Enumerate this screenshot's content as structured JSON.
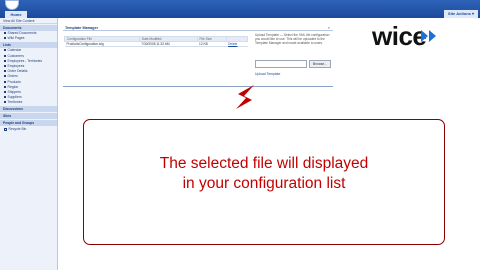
{
  "topbar": {
    "home_tab": "Home",
    "site_actions": "Site Actions ▾"
  },
  "sidebar": {
    "header": "View All Site Content",
    "groups": [
      {
        "label": "Documents",
        "items": [
          "Shared Documents",
          "Wiki Pages"
        ]
      },
      {
        "label": "Lists",
        "items": [
          "Calendar",
          "Customers",
          "Employees - Territories",
          "Employees",
          "Order Details",
          "Orders",
          "Products",
          "Region",
          "Shippers",
          "Suppliers",
          "Territories"
        ]
      }
    ],
    "discussions": "Discussions",
    "sites": "Sites",
    "people": "People and Groups",
    "recycle": "Recycle Bin"
  },
  "main": {
    "panel_title": "Template Manager",
    "panel_close": "×",
    "table": {
      "headers": [
        "Configuration File",
        "Date Modified",
        "File Size",
        ""
      ],
      "rows": [
        {
          "file": "ProductsConfiguration.wlg",
          "date": "7/30/2008 11:32 AM",
          "size": "12 KB",
          "action": "Delete"
        }
      ]
    },
    "description": "Upload Template — Select the XML file configuration you would like to use. This will be uploaded to the Template Manager and made available to users.",
    "browse_label": "Browse...",
    "upload_link": "Upload Template"
  },
  "logo": {
    "text": "wice"
  },
  "callout": {
    "line1": "The selected file will displayed",
    "line2": "in your configuration list"
  },
  "colors": {
    "topbar": "#1b4a9c",
    "sidebar_bg": "#edf2fa",
    "callout_text": "#c40000",
    "callout_border": "#8b0000",
    "logo_arrows": "#1e6fd9"
  }
}
